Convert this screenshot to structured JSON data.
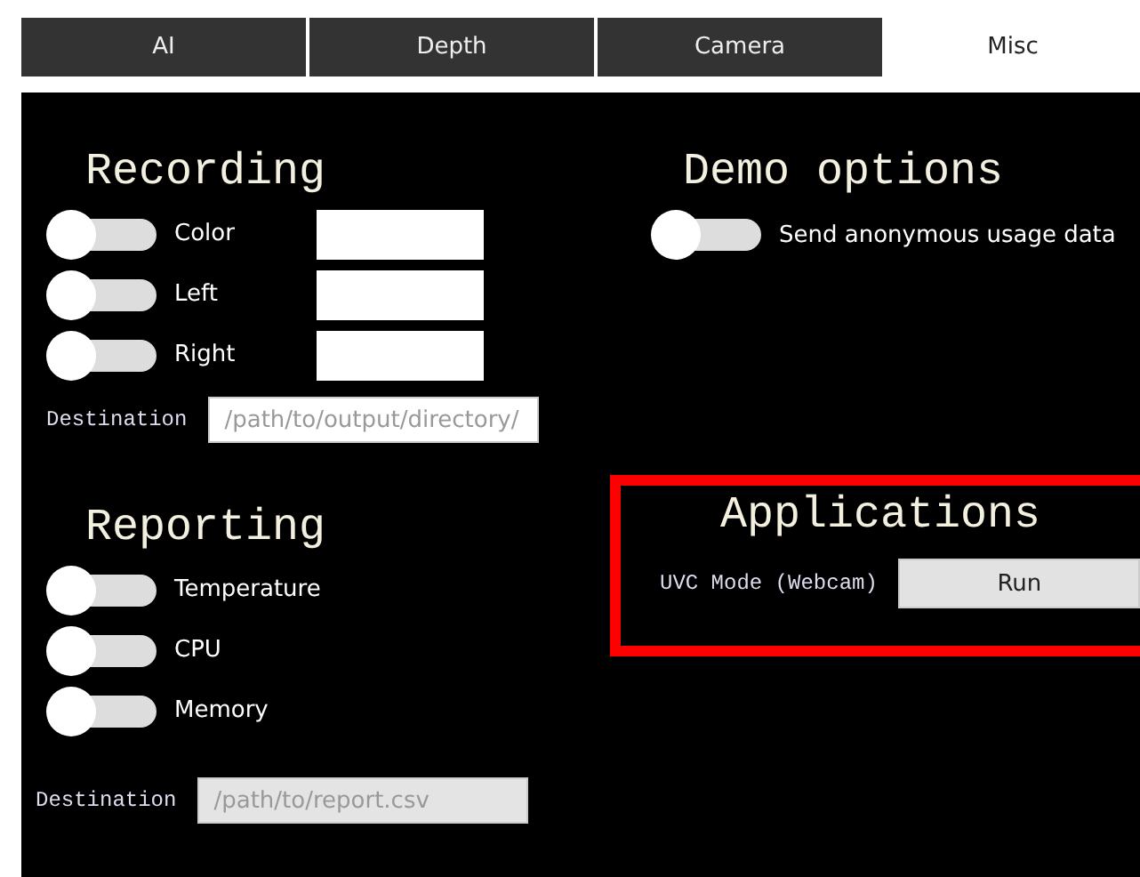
{
  "tabs": [
    {
      "label": "AI",
      "selected": false
    },
    {
      "label": "Depth",
      "selected": false
    },
    {
      "label": "Camera",
      "selected": false
    },
    {
      "label": "Misc",
      "selected": true
    }
  ],
  "recording": {
    "title": "Recording",
    "toggles": [
      {
        "label": "Color",
        "on": false
      },
      {
        "label": "Left",
        "on": false
      },
      {
        "label": "Right",
        "on": false
      }
    ],
    "destination": {
      "label": "Destination",
      "placeholder": "/path/to/output/directory/"
    }
  },
  "demo_options": {
    "title": "Demo options",
    "toggles": [
      {
        "label": "Send anonymous usage data",
        "on": false
      }
    ]
  },
  "reporting": {
    "title": "Reporting",
    "toggles": [
      {
        "label": "Temperature",
        "on": false
      },
      {
        "label": "CPU",
        "on": false
      },
      {
        "label": "Memory",
        "on": false
      }
    ],
    "destination": {
      "label": "Destination",
      "placeholder": "/path/to/report.csv"
    }
  },
  "applications": {
    "title": "Applications",
    "highlighted": true,
    "items": [
      {
        "label": "UVC Mode (Webcam)",
        "button": "Run"
      }
    ]
  }
}
